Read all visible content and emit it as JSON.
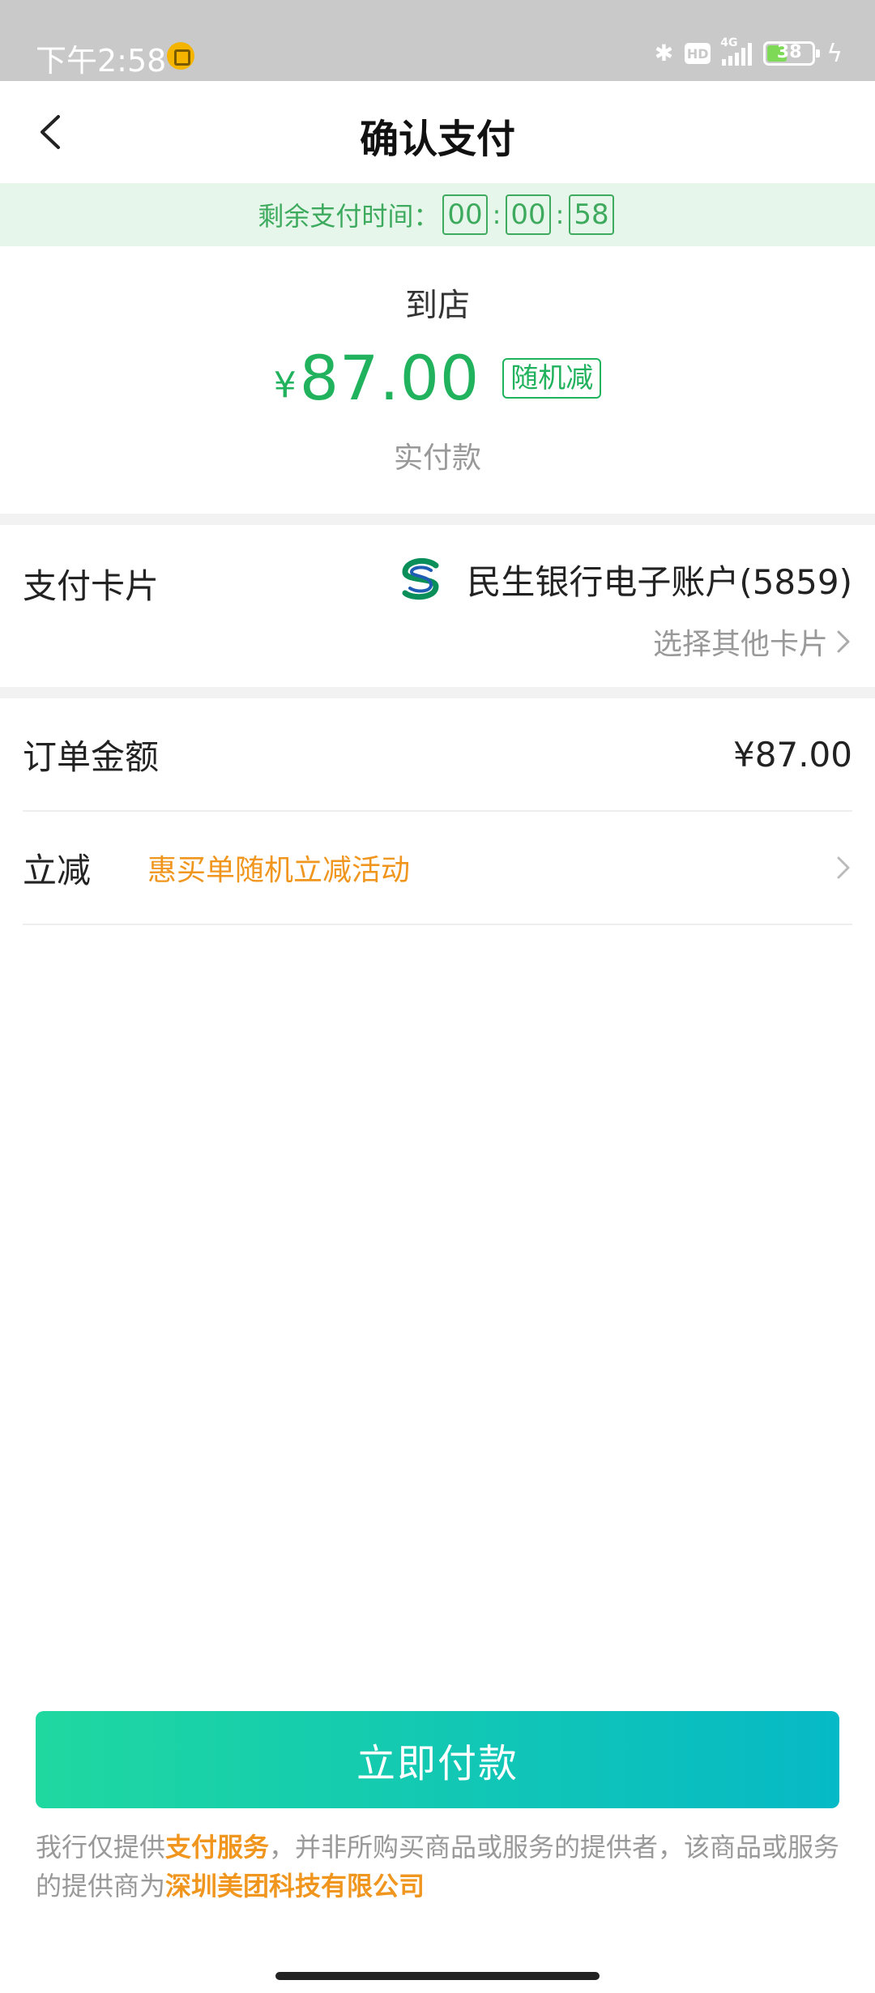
{
  "status_bar": {
    "time": "下午2:58",
    "network_badge": "HD",
    "network_type": "4G",
    "battery": "38"
  },
  "nav": {
    "title": "确认支付"
  },
  "timer": {
    "label": "剩余支付时间：",
    "hours": "00",
    "minutes": "00",
    "seconds": "58"
  },
  "payment": {
    "merchant": "到店",
    "currency": "¥",
    "amount": "87.00",
    "badge": "随机减",
    "amount_label": "实付款"
  },
  "card": {
    "label": "支付卡片",
    "bank_icon": "minsheng-bank-icon",
    "name": "民生银行电子账户(5859)",
    "other": "选择其他卡片"
  },
  "order": {
    "label": "订单金额",
    "value": "¥87.00"
  },
  "discount": {
    "label": "立减",
    "promo": "惠买单随机立减活动"
  },
  "actions": {
    "pay_now": "立即付款"
  },
  "disclaimer": {
    "p1": "我行仅提供",
    "h1": "支付服务",
    "p2": "，并非所购买商品或服务的提供者，该商品或服务的提供商为",
    "h2": "深圳美团科技有限公司"
  },
  "colors": {
    "accent_green": "#21b25d",
    "promo_orange": "#f0961e",
    "button_gradient_start": "#1fd8a0",
    "button_gradient_end": "#06b9c6"
  }
}
